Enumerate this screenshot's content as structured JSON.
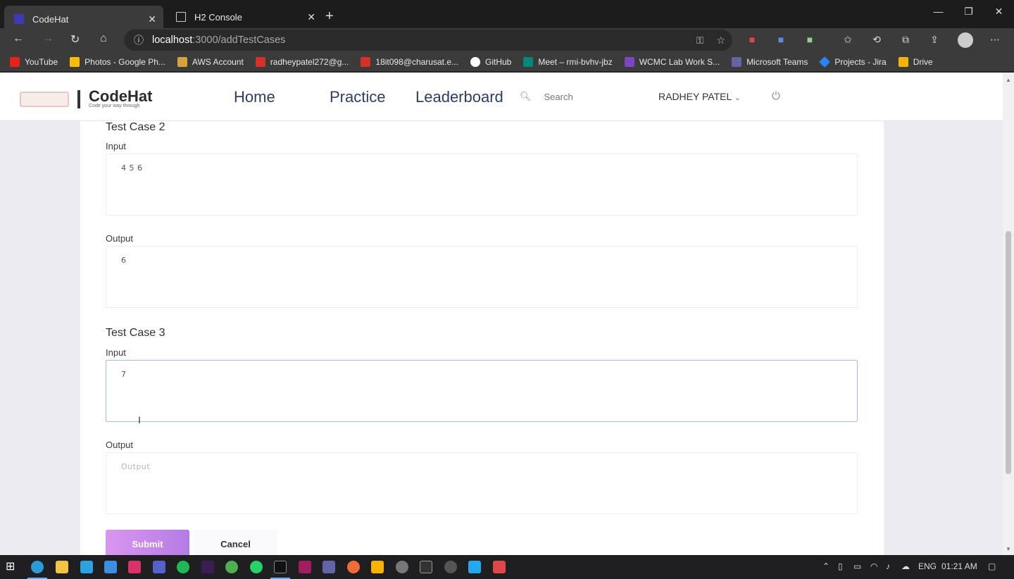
{
  "browser": {
    "tabs": [
      {
        "title": "CodeHat",
        "active": true
      },
      {
        "title": "H2 Console",
        "active": false
      }
    ],
    "url_host": "localhost",
    "url_path": ":3000/addTestCases",
    "bookmarks": [
      {
        "label": "YouTube",
        "color": "#e62117"
      },
      {
        "label": "Photos - Google Ph...",
        "color": "#fbbc04"
      },
      {
        "label": "AWS Account",
        "color": "#d8a23a"
      },
      {
        "label": "radheypatel272@g...",
        "color": "#d93025"
      },
      {
        "label": "18it098@charusat.e...",
        "color": "#d93025"
      },
      {
        "label": "GitHub",
        "color": "#ffffff"
      },
      {
        "label": "Meet – rmi-bvhv-jbz",
        "color": "#00897b"
      },
      {
        "label": "WCMC Lab Work S...",
        "color": "#7b45c6"
      },
      {
        "label": "Microsoft Teams",
        "color": "#6264a7"
      },
      {
        "label": "Projects - Jira",
        "color": "#2684ff"
      },
      {
        "label": "Drive",
        "color": "#f4b400"
      }
    ]
  },
  "app": {
    "logo_name": "CodeHat",
    "logo_tagline": "Code your way through",
    "nav": [
      "Home",
      "Practice",
      "Leaderboard"
    ],
    "search_placeholder": "Search",
    "user_name": "RADHEY PATEL"
  },
  "form": {
    "tc2": {
      "heading": "Test Case 2",
      "input_label": "Input",
      "input_value": "4 5 6",
      "output_label": "Output",
      "output_value": "6"
    },
    "tc3": {
      "heading": "Test Case 3",
      "input_label": "Input",
      "input_value": "7",
      "output_label": "Output",
      "output_placeholder": "Output"
    },
    "submit_label": "Submit",
    "cancel_label": "Cancel"
  },
  "taskbar": {
    "language": "ENG",
    "time": "01:21 AM"
  }
}
